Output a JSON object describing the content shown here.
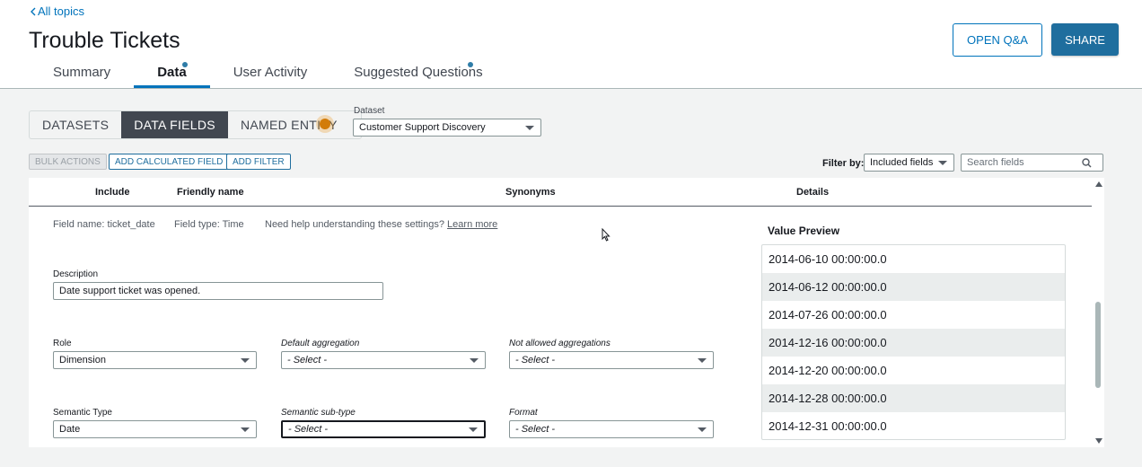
{
  "header": {
    "back_label": "All topics",
    "title": "Trouble Tickets",
    "open_qa_label": "OPEN Q&A",
    "share_label": "SHARE"
  },
  "tabs": [
    {
      "label": "Summary",
      "active": false,
      "dot": false
    },
    {
      "label": "Data",
      "active": true,
      "dot": true
    },
    {
      "label": "User Activity",
      "active": false,
      "dot": false
    },
    {
      "label": "Suggested Questions",
      "active": false,
      "dot": true
    }
  ],
  "segments": [
    {
      "label": "DATASETS",
      "active": false
    },
    {
      "label": "DATA FIELDS",
      "active": true
    },
    {
      "label": "NAMED ENTITY",
      "active": false
    }
  ],
  "dataset": {
    "label": "Dataset",
    "value": "Customer Support Discovery"
  },
  "actions": {
    "bulk_actions": "BULK ACTIONS",
    "add_calculated_field": "ADD CALCULATED FIELD",
    "add_filter": "ADD FILTER"
  },
  "filter": {
    "label": "Filter by:",
    "value": "Included fields",
    "search_placeholder": "Search fields"
  },
  "columns": {
    "include": "Include",
    "friendly_name": "Friendly name",
    "synonyms": "Synonyms",
    "details": "Details"
  },
  "field": {
    "name_text": "Field name: ticket_date",
    "type_text": "Field type: Time",
    "help_text": "Need help understanding these settings?",
    "learn_more": "Learn more",
    "description_label": "Description",
    "description_value": "Date support ticket was opened.",
    "role_label": "Role",
    "role_value": "Dimension",
    "default_agg_label": "Default aggregation",
    "default_agg_value": "- Select -",
    "not_allowed_agg_label": "Not allowed aggregations",
    "not_allowed_agg_value": "- Select -",
    "semantic_type_label": "Semantic Type",
    "semantic_type_value": "Date",
    "semantic_subtype_label": "Semantic sub-type",
    "semantic_subtype_value": "- Select -",
    "format_label": "Format",
    "format_value": "- Select -"
  },
  "value_preview": {
    "title": "Value Preview",
    "values": [
      "2014-06-10 00:00:00.0",
      "2014-06-12 00:00:00.0",
      "2014-07-26 00:00:00.0",
      "2014-12-16 00:00:00.0",
      "2014-12-20 00:00:00.0",
      "2014-12-28 00:00:00.0",
      "2014-12-31 00:00:00.0"
    ]
  },
  "colors": {
    "accent": "#0073bb",
    "primary_button": "#1f6e9e",
    "active_segment": "#414750",
    "notification_dot": "#d27c0a"
  }
}
